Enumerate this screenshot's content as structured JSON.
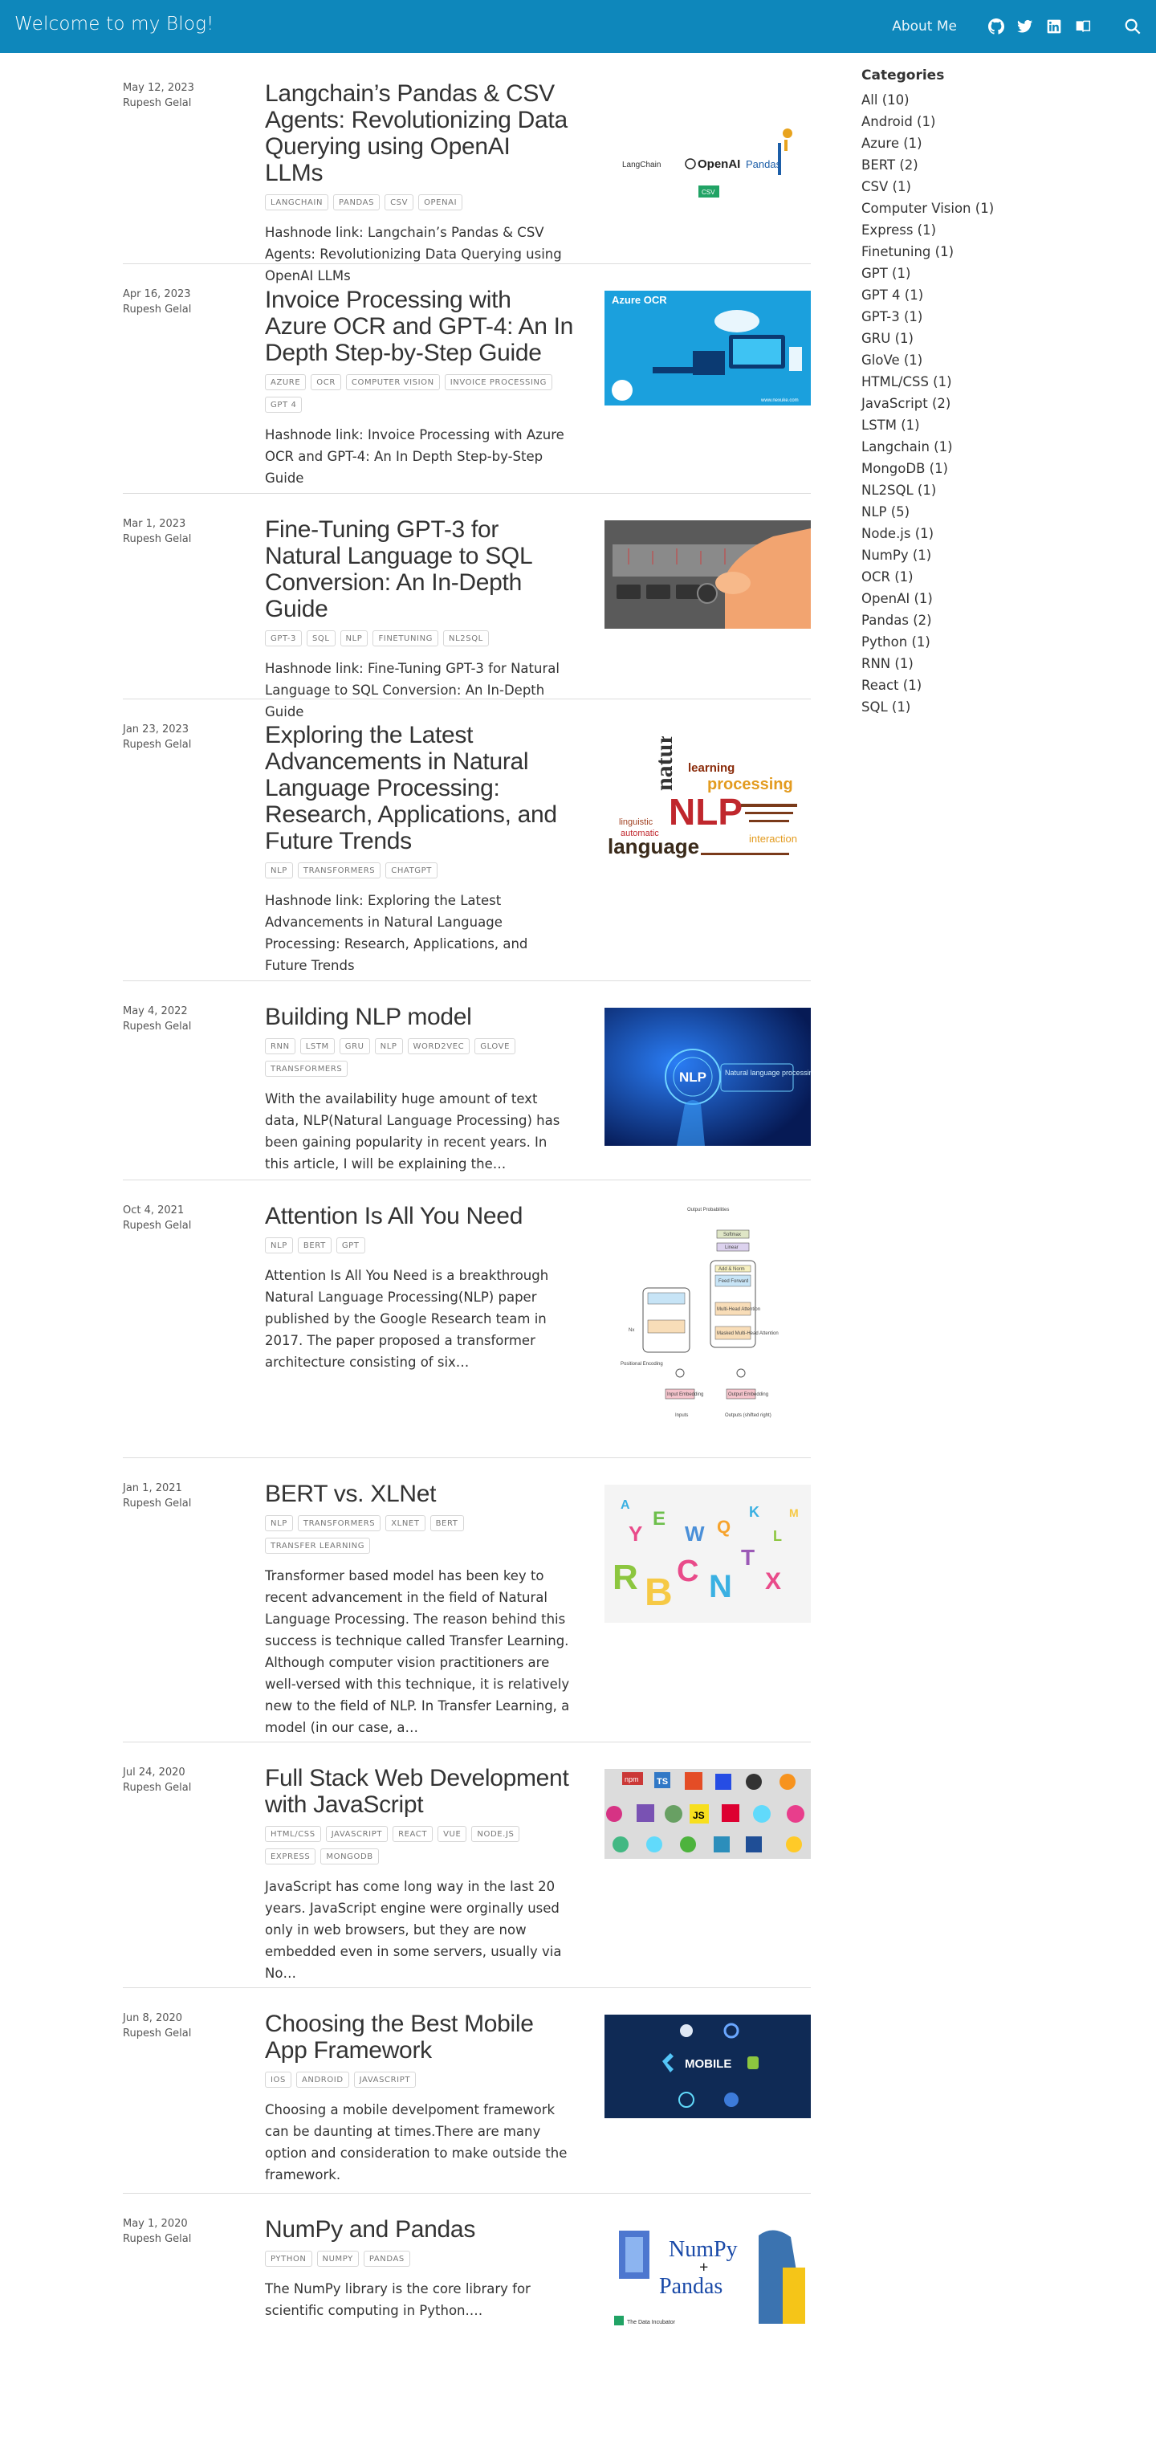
{
  "header": {
    "site_title": "Welcome to my Blog!",
    "about": "About Me",
    "icons": [
      "github-icon",
      "twitter-icon",
      "linkedin-icon",
      "book-icon",
      "search-icon"
    ]
  },
  "sidebar": {
    "title": "Categories",
    "items": [
      "All (10)",
      "Android (1)",
      "Azure (1)",
      "BERT (2)",
      "CSV (1)",
      "Computer Vision (1)",
      "Express (1)",
      "Finetuning (1)",
      "GPT (1)",
      "GPT 4 (1)",
      "GPT-3 (1)",
      "GRU (1)",
      "GloVe (1)",
      "HTML/CSS (1)",
      "JavaScript (2)",
      "LSTM (1)",
      "Langchain (1)",
      "MongoDB (1)",
      "NL2SQL (1)",
      "NLP (5)",
      "Node.js (1)",
      "NumPy (1)",
      "OCR (1)",
      "OpenAI (1)",
      "Pandas (2)",
      "Python (1)",
      "RNN (1)",
      "React (1)",
      "SQL (1)"
    ]
  },
  "posts": [
    {
      "date": "May 12, 2023",
      "author": "Rupesh Gelal",
      "title": "Langchain’s Pandas & CSV Agents: Revolutionizing Data Querying using OpenAI LLMs",
      "tags": [
        "LANGCHAIN",
        "PANDAS",
        "CSV",
        "OPENAI"
      ],
      "excerpt": "Hashnode link: Langchain’s Pandas & CSV Agents: Revolutionizing Data Querying using OpenAI LLMs",
      "image_labels": [
        "LangChain",
        "OpenAI",
        "Pandas",
        "CSV"
      ]
    },
    {
      "date": "Apr 16, 2023",
      "author": "Rupesh Gelal",
      "title": "Invoice Processing with Azure OCR and GPT-4: An In Depth Step-by-Step Guide",
      "tags": [
        "AZURE",
        "OCR",
        "COMPUTER VISION",
        "INVOICE PROCESSING",
        "GPT 4"
      ],
      "excerpt": "Hashnode link: Invoice Processing with Azure OCR and GPT-4: An In Depth Step-by-Step Guide",
      "image_labels": [
        "Azure OCR",
        "www.nexuke.com"
      ]
    },
    {
      "date": "Mar 1, 2023",
      "author": "Rupesh Gelal",
      "title": "Fine-Tuning GPT-3 for Natural Language to SQL Conversion: An In-Depth Guide",
      "tags": [
        "GPT-3",
        "SQL",
        "NLP",
        "FINETUNING",
        "NL2SQL"
      ],
      "excerpt": "Hashnode link: Fine-Tuning GPT-3 for Natural Language to SQL Conversion: An In-Depth Guide"
    },
    {
      "date": "Jan 23, 2023",
      "author": "Rupesh Gelal",
      "title": "Exploring the Latest Advancements in Natural Language Processing: Research, Applications, and Future Trends",
      "tags": [
        "NLP",
        "TRANSFORMERS",
        "CHATGPT"
      ],
      "excerpt": "Hashnode link: Exploring the Latest Advancements in Natural Language Processing: Research, Applications, and Future Trends",
      "image_labels": [
        "natural",
        "NLP",
        "learning",
        "processing",
        "language",
        "linguistic",
        "automatic",
        "interaction"
      ]
    },
    {
      "date": "May 4, 2022",
      "author": "Rupesh Gelal",
      "title": "Building NLP model",
      "tags": [
        "RNN",
        "LSTM",
        "GRU",
        "NLP",
        "WORD2VEC",
        "GLOVE",
        "TRANSFORMERS"
      ],
      "excerpt": "With the availability huge amount of text data, NLP(Natural Language Processing) has been gaining popularity in recent years. In this article, I will be explaining the…",
      "image_labels": [
        "NLP",
        "Natural language processing"
      ]
    },
    {
      "date": "Oct 4, 2021",
      "author": "Rupesh Gelal",
      "title": "Attention Is All You Need",
      "tags": [
        "NLP",
        "BERT",
        "GPT"
      ],
      "excerpt": "Attention Is All You Need is a breakthrough Natural Language Processing(NLP) paper published by the Google Research team in 2017. The paper proposed a transformer architecture consisting of six…",
      "image_labels": [
        "Output Probabilities",
        "Softmax",
        "Linear",
        "Add & Norm",
        "Feed Forward",
        "Multi-Head Attention",
        "Masked Multi-Head Attention",
        "Positional Encoding",
        "Input Embedding",
        "Output Embedding",
        "Inputs",
        "Outputs (shifted right)",
        "Nx"
      ]
    },
    {
      "date": "Jan 1, 2021",
      "author": "Rupesh Gelal",
      "title": "BERT vs. XLNet",
      "tags": [
        "NLP",
        "TRANSFORMERS",
        "XLNET",
        "BERT",
        "TRANSFER LEARNING"
      ],
      "excerpt": "Transformer based model has been key to recent advancement in the field of Natural Language Processing. The reason behind this success is technique called Transfer Learning. Although computer vision practitioners are well-versed with this technique, it is relatively new to the field of NLP. In Transfer Learning, a model (in our case, a…"
    },
    {
      "date": "Jul 24, 2020",
      "author": "Rupesh Gelal",
      "title": "Full Stack Web Development with JavaScript",
      "tags": [
        "HTML/CSS",
        "JAVASCRIPT",
        "REACT",
        "VUE",
        "NODE.JS",
        "EXPRESS",
        "MONGODB"
      ],
      "excerpt": "JavaScript has come long way in the last 20 years. JavaScript engine were orginally used only in web browsers, but they are now embedded even in some servers, usually via No…",
      "image_labels": [
        "TS",
        "JS",
        "npm"
      ]
    },
    {
      "date": "Jun 8, 2020",
      "author": "Rupesh Gelal",
      "title": "Choosing the Best Mobile App Framework",
      "tags": [
        "IOS",
        "ANDROID",
        "JAVASCRIPT"
      ],
      "excerpt": "Choosing a mobile develpoment framework can be daunting at times.There are many option and consideration to make outside the framework.",
      "image_labels": [
        "MOBILE"
      ]
    },
    {
      "date": "May 1, 2020",
      "author": "Rupesh Gelal",
      "title": "NumPy and Pandas",
      "tags": [
        "PYTHON",
        "NUMPY",
        "PANDAS"
      ],
      "excerpt": "The NumPy library is the core library for scientific computing in Python.…",
      "image_labels": [
        "NumPy",
        "+",
        "Pandas",
        "The Data Incubator"
      ]
    }
  ]
}
